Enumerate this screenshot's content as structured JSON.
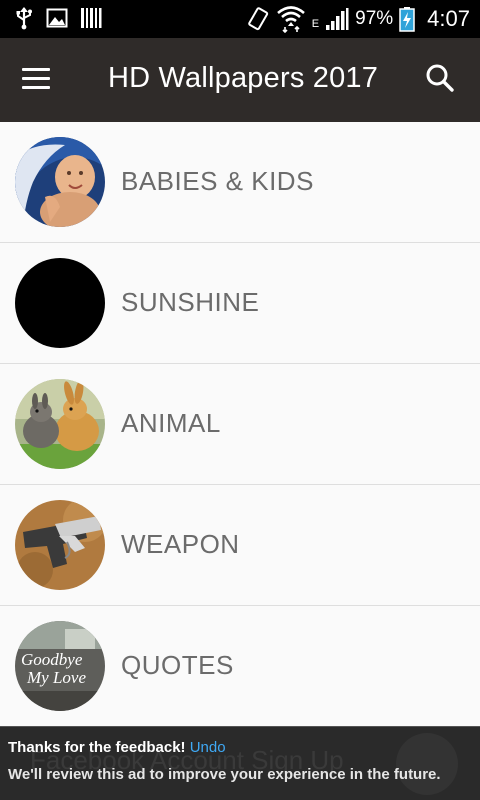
{
  "status_bar": {
    "left_icons": [
      "usb-icon",
      "image-icon",
      "barcode-icon"
    ],
    "right_icons": [
      "vibrate-icon",
      "wifi-icon",
      "signal-icon",
      "battery-charging-icon"
    ],
    "network_type": "E",
    "battery_percent": "97%",
    "time": "4:07"
  },
  "app_bar": {
    "menu_icon": "hamburger-menu-icon",
    "title": "HD Wallpapers 2017",
    "search_icon": "search-icon",
    "background_color": "#2f2b29"
  },
  "categories": [
    {
      "label": "BABIES & KIDS",
      "thumbnail": "baby-photo"
    },
    {
      "label": "SUNSHINE",
      "thumbnail": "black-circle"
    },
    {
      "label": "ANIMAL",
      "thumbnail": "rabbits-photo"
    },
    {
      "label": "WEAPON",
      "thumbnail": "pistol-photo"
    },
    {
      "label": "QUOTES",
      "thumbnail": "goodbye-photo",
      "thumbnail_text": [
        "Goodbye",
        "My Love"
      ]
    }
  ],
  "ad_feedback": {
    "title": "Thanks for the feedback!",
    "undo_label": "Undo",
    "message": "We'll review this ad to improve your experience in the future.",
    "background_text": "Facebook Account Sign Up",
    "undo_color": "#3fa9f5"
  }
}
